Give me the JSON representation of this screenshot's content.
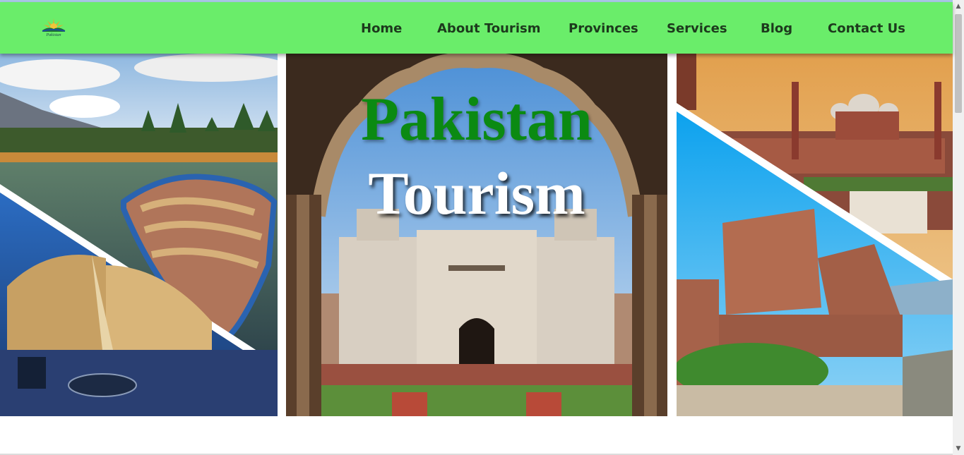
{
  "brand": {
    "logo_text": "Pakistan"
  },
  "nav": {
    "items": [
      {
        "label": "Home"
      },
      {
        "label": "About Tourism"
      },
      {
        "label": "Provinces"
      },
      {
        "label": "Services"
      },
      {
        "label": "Blog"
      },
      {
        "label": "Contact Us"
      }
    ]
  },
  "hero": {
    "title_line1": "Pakistan",
    "title_line2": "Tourism"
  },
  "colors": {
    "navbar": "#6aed6a",
    "title_green": "#0b8a12",
    "title_white": "#ffffff"
  },
  "icons": [
    "logo-icon"
  ]
}
